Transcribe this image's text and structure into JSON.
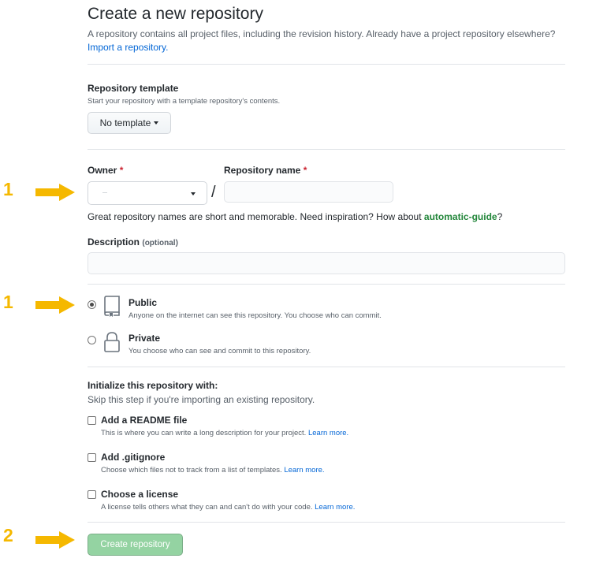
{
  "header": {
    "title": "Create a new repository",
    "description": "A repository contains all project files, including the revision history. Already have a project repository elsewhere?",
    "import_link": "Import a repository."
  },
  "template": {
    "label": "Repository template",
    "note": "Start your repository with a template repository's contents.",
    "button_label": "No template"
  },
  "owner": {
    "label": "Owner",
    "required_mark": "*",
    "value": ""
  },
  "repo_name": {
    "label": "Repository name",
    "required_mark": "*",
    "value": ""
  },
  "separator": "/",
  "suggestion": {
    "text": "Great repository names are short and memorable. Need inspiration? How about",
    "name": "automatic-guide",
    "suffix": "?"
  },
  "description_field": {
    "label": "Description",
    "optional": "(optional)",
    "value": ""
  },
  "visibility": {
    "selected": "public",
    "options": [
      {
        "title": "Public",
        "note": "Anyone on the internet can see this repository. You choose who can commit.",
        "icon": "repo-icon"
      },
      {
        "title": "Private",
        "note": "You choose who can see and commit to this repository.",
        "icon": "lock-icon"
      }
    ]
  },
  "initialize": {
    "heading": "Initialize this repository with:",
    "note": "Skip this step if you're importing an existing repository.",
    "options": [
      {
        "title": "Add a README file",
        "note": "This is where you can write a long description for your project.",
        "learn": "Learn more.",
        "checked": false
      },
      {
        "title": "Add .gitignore",
        "note": "Choose which files not to track from a list of templates.",
        "learn": "Learn more.",
        "checked": false
      },
      {
        "title": "Choose a license",
        "note": "A license tells others what they can and can't do with your code.",
        "learn": "Learn more.",
        "checked": false
      }
    ]
  },
  "submit": {
    "label": "Create repository",
    "enabled": false
  },
  "annotations": {
    "markers": [
      {
        "number": "1",
        "target": "owner-and-name"
      },
      {
        "number": "1",
        "target": "visibility"
      },
      {
        "number": "2",
        "target": "create-button"
      }
    ],
    "color": "#f5b800"
  },
  "colors": {
    "link": "#0366d6",
    "required": "#cb2431",
    "suggestion": "#22863a",
    "primary_disabled": "#94d3a2"
  }
}
